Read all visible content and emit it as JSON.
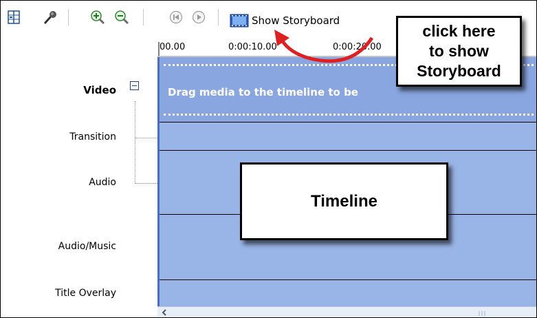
{
  "toolbar": {
    "icons": [
      "storyboard-toggle-icon",
      "narrate-microphone-icon",
      "zoom-in-icon",
      "zoom-out-icon",
      "rewind-icon",
      "play-icon",
      "filmstrip-icon"
    ],
    "show_storyboard_label": "Show Storyboard"
  },
  "ruler": {
    "ticks": [
      "00.00",
      "0:00:10.00",
      "0:00:20.00"
    ]
  },
  "tracks": {
    "video_label": "Video",
    "transition_label": "Transition",
    "audio_label": "Audio",
    "audio_music_label": "Audio/Music",
    "title_overlay_label": "Title Overlay",
    "drag_hint": "Drag media to the timeline to be"
  },
  "callouts": {
    "storyboard_line1": "click here",
    "storyboard_line2": "to show",
    "storyboard_line3": "Storyboard",
    "timeline": "Timeline"
  },
  "colors": {
    "track_bg": "#99b4e6",
    "video_track_bg": "#8aa6e0",
    "arrow": "#e02020"
  }
}
